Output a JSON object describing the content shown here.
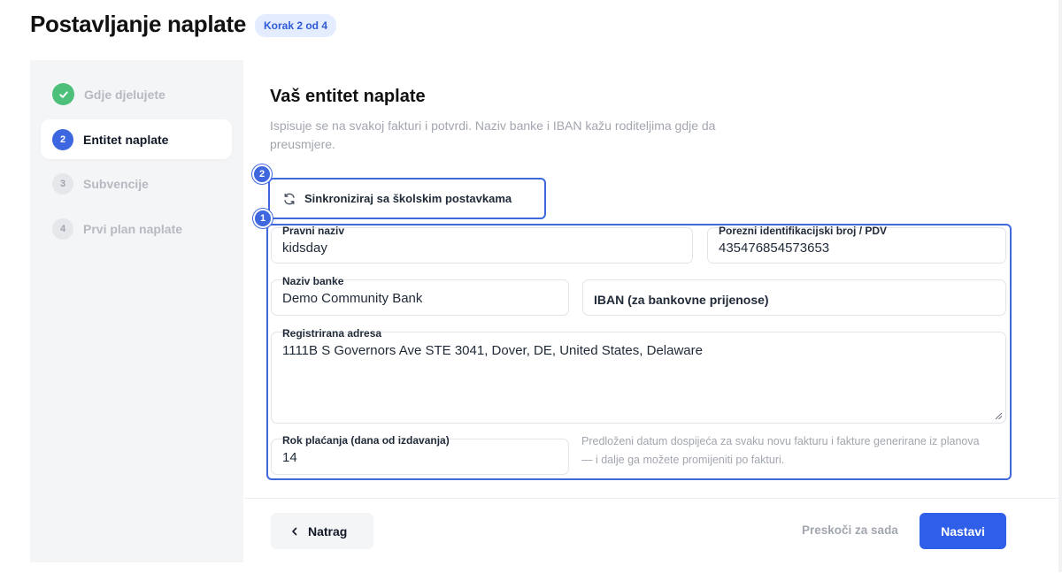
{
  "header": {
    "title": "Postavljanje naplate",
    "step_badge": "Korak 2 od 4"
  },
  "sidebar": {
    "steps": [
      {
        "number": "",
        "label": "Gdje djelujete",
        "state": "done",
        "icon": "check-icon"
      },
      {
        "number": "2",
        "label": "Entitet naplate",
        "state": "current"
      },
      {
        "number": "3",
        "label": "Subvencije",
        "state": "todo"
      },
      {
        "number": "4",
        "label": "Prvi plan naplate",
        "state": "todo"
      }
    ]
  },
  "main": {
    "title": "Vaš entitet naplate",
    "description": "Ispisuje se na svakoj fakturi i potvrdi. Naziv banke i IBAN kažu roditeljima gdje da preusmjere.",
    "sync_button": {
      "label": "Sinkroniziraj sa školskim postavkama",
      "icon": "refresh-icon"
    },
    "markers": {
      "form": "1",
      "sync": "2"
    },
    "form": {
      "legal_name": {
        "label": "Pravni naziv",
        "value": "kidsday"
      },
      "tax_id": {
        "label": "Porezni identifikacijski broj / PDV",
        "value": "435476854573653"
      },
      "bank_name": {
        "label": "Naziv banke",
        "value": "Demo Community Bank"
      },
      "iban": {
        "placeholder": "IBAN (za bankovne prijenose)"
      },
      "address": {
        "label": "Registrirana adresa",
        "value": "1111B S Governors Ave STE 3041, Dover, DE, United States, Delaware"
      },
      "payment_term": {
        "label": "Rok plaćanja (dana od izdavanja)",
        "value": "14"
      },
      "payment_term_hint": "Predloženi datum dospijeća za svaku novu fakturu i fakture generirane iz planova — i dalje ga možete promijeniti po fakturi."
    },
    "footer": {
      "back_label": "Natrag",
      "skip_label": "Preskoči za sada",
      "next_label": "Nastavi"
    }
  },
  "colors": {
    "accent": "#2f5ee8",
    "highlight": "#3f68df",
    "success": "#4cc07a",
    "muted_text": "#a2a6ae"
  }
}
